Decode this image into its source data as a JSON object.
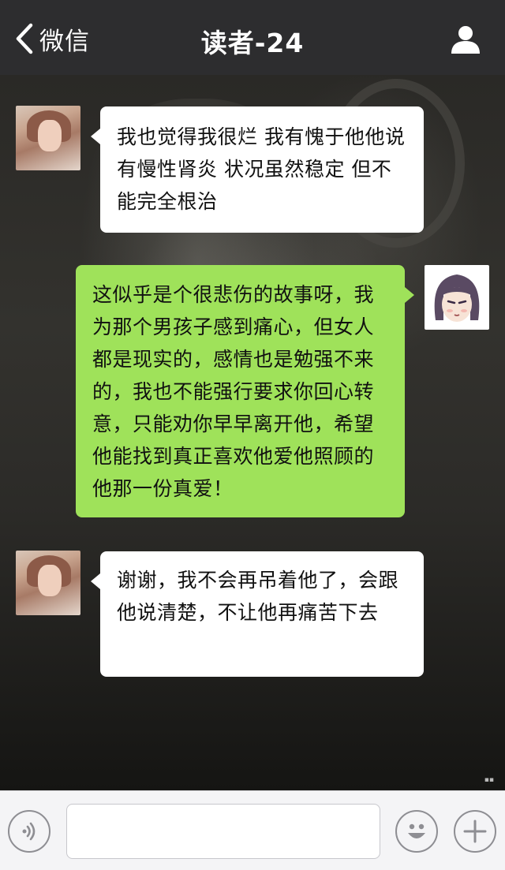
{
  "header": {
    "back_label": "微信",
    "title": "读者-24"
  },
  "messages": [
    {
      "side": "left",
      "text": "我也觉得我很烂 我有愧于他他说有慢性肾炎 状况虽然稳定 但不能完全根治"
    },
    {
      "side": "right",
      "text": "这似乎是个很悲伤的故事呀，我为那个男孩子感到痛心，但女人都是现实的，感情也是勉强不来的，我也不能强行要求你回心转意，只能劝你早早离开他，希望他能找到真正喜欢他爱他照顾的他那一份真爱！"
    },
    {
      "side": "left",
      "text": "谢谢，我不会再吊着他了，会跟他说清楚，不让他再痛苦下去"
    }
  ],
  "input_bar": {
    "message_value": ""
  },
  "colors": {
    "header_bg": "#2d2d2f",
    "sent_bubble": "#9fe25a",
    "received_bubble": "#ffffff",
    "input_bar_bg": "#f4f4f6"
  },
  "icons": {
    "back": "chevron-left-icon",
    "profile": "person-icon",
    "voice": "voice-icon",
    "emoji": "smiley-icon",
    "more": "plus-icon"
  }
}
